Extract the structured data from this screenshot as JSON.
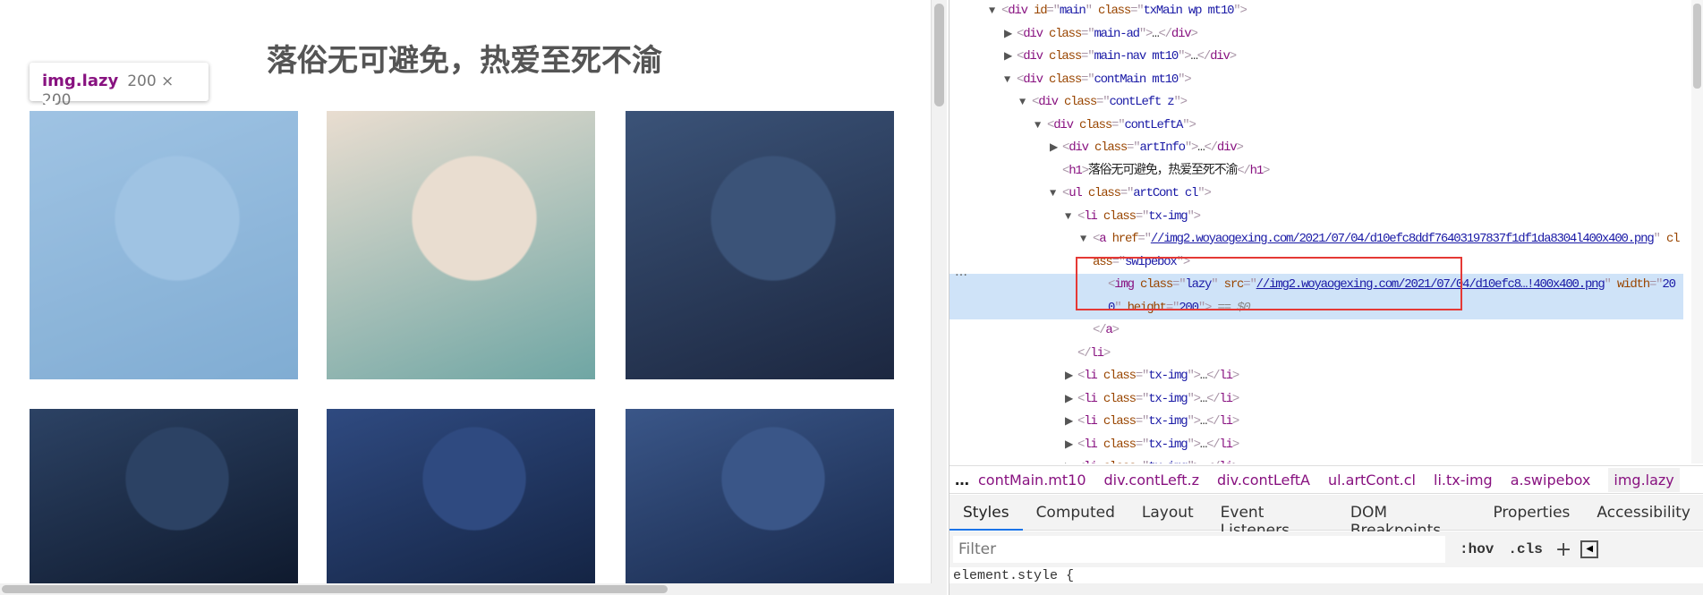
{
  "page": {
    "title": "落俗无可避免，热爱至死不渝",
    "photos": [
      {
        "alt": "photo-1",
        "colors": [
          "#c7d9ea",
          "#8fb0cc"
        ],
        "highlighted": true
      },
      {
        "alt": "photo-2",
        "colors": [
          "#e9ddd0",
          "#6fa6a4"
        ]
      },
      {
        "alt": "photo-3",
        "colors": [
          "#3b5378",
          "#1c2740"
        ]
      },
      {
        "alt": "photo-4",
        "colors": [
          "#2c4264",
          "#0f1a2e"
        ]
      },
      {
        "alt": "photo-5",
        "colors": [
          "#2f4a80",
          "#142444"
        ]
      },
      {
        "alt": "photo-6",
        "colors": [
          "#3a5688",
          "#18294c"
        ]
      }
    ],
    "tooltip": {
      "selector": "img.lazy",
      "size": "200 × 200"
    }
  },
  "devtools": {
    "tree": [
      {
        "level": 0,
        "arrow": "▼",
        "parts": [
          [
            "punct",
            "<"
          ],
          [
            "tag",
            "div"
          ],
          [
            "text",
            " "
          ],
          [
            "attr",
            "id"
          ],
          [
            "punct",
            "=\""
          ],
          [
            "val",
            "main"
          ],
          [
            "punct",
            "\" "
          ],
          [
            "attr",
            "class"
          ],
          [
            "punct",
            "=\""
          ],
          [
            "val",
            "txMain wp mt10"
          ],
          [
            "punct",
            "\">"
          ]
        ]
      },
      {
        "level": 1,
        "arrow": "▶",
        "parts": [
          [
            "punct",
            "<"
          ],
          [
            "tag",
            "div"
          ],
          [
            "text",
            " "
          ],
          [
            "attr",
            "class"
          ],
          [
            "punct",
            "=\""
          ],
          [
            "val",
            "main-ad"
          ],
          [
            "punct",
            "\">"
          ],
          [
            "text",
            "…"
          ],
          [
            "punct",
            "</"
          ],
          [
            "tag",
            "div"
          ],
          [
            "punct",
            ">"
          ]
        ]
      },
      {
        "level": 1,
        "arrow": "▶",
        "parts": [
          [
            "punct",
            "<"
          ],
          [
            "tag",
            "div"
          ],
          [
            "text",
            " "
          ],
          [
            "attr",
            "class"
          ],
          [
            "punct",
            "=\""
          ],
          [
            "val",
            "main-nav mt10"
          ],
          [
            "punct",
            "\">"
          ],
          [
            "text",
            "…"
          ],
          [
            "punct",
            "</"
          ],
          [
            "tag",
            "div"
          ],
          [
            "punct",
            ">"
          ]
        ]
      },
      {
        "level": 1,
        "arrow": "▼",
        "parts": [
          [
            "punct",
            "<"
          ],
          [
            "tag",
            "div"
          ],
          [
            "text",
            " "
          ],
          [
            "attr",
            "class"
          ],
          [
            "punct",
            "=\""
          ],
          [
            "val",
            "contMain mt10"
          ],
          [
            "punct",
            "\">"
          ]
        ]
      },
      {
        "level": 2,
        "arrow": "▼",
        "parts": [
          [
            "punct",
            "<"
          ],
          [
            "tag",
            "div"
          ],
          [
            "text",
            " "
          ],
          [
            "attr",
            "class"
          ],
          [
            "punct",
            "=\""
          ],
          [
            "val",
            "contLeft z"
          ],
          [
            "punct",
            "\">"
          ]
        ]
      },
      {
        "level": 3,
        "arrow": "▼",
        "parts": [
          [
            "punct",
            "<"
          ],
          [
            "tag",
            "div"
          ],
          [
            "text",
            " "
          ],
          [
            "attr",
            "class"
          ],
          [
            "punct",
            "=\""
          ],
          [
            "val",
            "contLeftA"
          ],
          [
            "punct",
            "\">"
          ]
        ]
      },
      {
        "level": 4,
        "arrow": "▶",
        "parts": [
          [
            "punct",
            "<"
          ],
          [
            "tag",
            "div"
          ],
          [
            "text",
            " "
          ],
          [
            "attr",
            "class"
          ],
          [
            "punct",
            "=\""
          ],
          [
            "val",
            "artInfo"
          ],
          [
            "punct",
            "\">"
          ],
          [
            "text",
            "…"
          ],
          [
            "punct",
            "</"
          ],
          [
            "tag",
            "div"
          ],
          [
            "punct",
            ">"
          ]
        ]
      },
      {
        "level": 4,
        "arrow": "",
        "parts": [
          [
            "punct",
            "<"
          ],
          [
            "tag",
            "h1"
          ],
          [
            "punct",
            ">"
          ],
          [
            "text",
            "落俗无可避免，热爱至死不渝"
          ],
          [
            "punct",
            "</"
          ],
          [
            "tag",
            "h1"
          ],
          [
            "punct",
            ">"
          ]
        ]
      },
      {
        "level": 4,
        "arrow": "▼",
        "parts": [
          [
            "punct",
            "<"
          ],
          [
            "tag",
            "ul"
          ],
          [
            "text",
            " "
          ],
          [
            "attr",
            "class"
          ],
          [
            "punct",
            "=\""
          ],
          [
            "val",
            "artCont cl"
          ],
          [
            "punct",
            "\">"
          ]
        ]
      },
      {
        "level": 5,
        "arrow": "▼",
        "parts": [
          [
            "punct",
            "<"
          ],
          [
            "tag",
            "li"
          ],
          [
            "text",
            " "
          ],
          [
            "attr",
            "class"
          ],
          [
            "punct",
            "=\""
          ],
          [
            "val",
            "tx-img"
          ],
          [
            "punct",
            "\">"
          ]
        ]
      },
      {
        "level": 6,
        "arrow": "▼",
        "wrap": true,
        "parts": [
          [
            "punct",
            "<"
          ],
          [
            "tag",
            "a"
          ],
          [
            "text",
            " "
          ],
          [
            "attr",
            "href"
          ],
          [
            "punct",
            "=\""
          ],
          [
            "link",
            "//img2.woyaogexing.com/2021/07/04/d10efc8ddf76403197837f1df1da8304l400x400.png"
          ],
          [
            "punct",
            "\" "
          ],
          [
            "attr",
            "class"
          ],
          [
            "punct",
            "=\""
          ],
          [
            "val",
            "swipebox"
          ],
          [
            "punct",
            "\">"
          ]
        ]
      },
      {
        "level": 7,
        "arrow": "",
        "wrap": true,
        "selected": true,
        "parts": [
          [
            "punct",
            "<"
          ],
          [
            "tag",
            "img"
          ],
          [
            "text",
            " "
          ],
          [
            "attr",
            "class"
          ],
          [
            "punct",
            "=\""
          ],
          [
            "val",
            "lazy"
          ],
          [
            "punct",
            "\" "
          ],
          [
            "attr",
            "src"
          ],
          [
            "punct",
            "=\""
          ],
          [
            "link",
            "//img2.woyaogexing.com/2021/07/04/d10efc8…!400x400.png"
          ],
          [
            "punct",
            "\" "
          ],
          [
            "attr",
            "width"
          ],
          [
            "punct",
            "=\""
          ],
          [
            "val",
            "200"
          ],
          [
            "punct",
            "\" "
          ],
          [
            "attr",
            "height"
          ],
          [
            "punct",
            "=\""
          ],
          [
            "val",
            "200"
          ],
          [
            "punct",
            "\">"
          ],
          [
            "eq",
            " == $0"
          ]
        ]
      },
      {
        "level": 6,
        "arrow": "",
        "parts": [
          [
            "punct",
            "</"
          ],
          [
            "tag",
            "a"
          ],
          [
            "punct",
            ">"
          ]
        ]
      },
      {
        "level": 5,
        "arrow": "",
        "parts": [
          [
            "punct",
            "</"
          ],
          [
            "tag",
            "li"
          ],
          [
            "punct",
            ">"
          ]
        ]
      },
      {
        "level": 5,
        "arrow": "▶",
        "parts": [
          [
            "punct",
            "<"
          ],
          [
            "tag",
            "li"
          ],
          [
            "text",
            " "
          ],
          [
            "attr",
            "class"
          ],
          [
            "punct",
            "=\""
          ],
          [
            "val",
            "tx-img"
          ],
          [
            "punct",
            "\">"
          ],
          [
            "text",
            "…"
          ],
          [
            "punct",
            "</"
          ],
          [
            "tag",
            "li"
          ],
          [
            "punct",
            ">"
          ]
        ]
      },
      {
        "level": 5,
        "arrow": "▶",
        "parts": [
          [
            "punct",
            "<"
          ],
          [
            "tag",
            "li"
          ],
          [
            "text",
            " "
          ],
          [
            "attr",
            "class"
          ],
          [
            "punct",
            "=\""
          ],
          [
            "val",
            "tx-img"
          ],
          [
            "punct",
            "\">"
          ],
          [
            "text",
            "…"
          ],
          [
            "punct",
            "</"
          ],
          [
            "tag",
            "li"
          ],
          [
            "punct",
            ">"
          ]
        ]
      },
      {
        "level": 5,
        "arrow": "▶",
        "parts": [
          [
            "punct",
            "<"
          ],
          [
            "tag",
            "li"
          ],
          [
            "text",
            " "
          ],
          [
            "attr",
            "class"
          ],
          [
            "punct",
            "=\""
          ],
          [
            "val",
            "tx-img"
          ],
          [
            "punct",
            "\">"
          ],
          [
            "text",
            "…"
          ],
          [
            "punct",
            "</"
          ],
          [
            "tag",
            "li"
          ],
          [
            "punct",
            ">"
          ]
        ]
      },
      {
        "level": 5,
        "arrow": "▶",
        "parts": [
          [
            "punct",
            "<"
          ],
          [
            "tag",
            "li"
          ],
          [
            "text",
            " "
          ],
          [
            "attr",
            "class"
          ],
          [
            "punct",
            "=\""
          ],
          [
            "val",
            "tx-img"
          ],
          [
            "punct",
            "\">"
          ],
          [
            "text",
            "…"
          ],
          [
            "punct",
            "</"
          ],
          [
            "tag",
            "li"
          ],
          [
            "punct",
            ">"
          ]
        ]
      },
      {
        "level": 5,
        "arrow": "▶",
        "parts": [
          [
            "punct",
            "<"
          ],
          [
            "tag",
            "li"
          ],
          [
            "text",
            " "
          ],
          [
            "attr",
            "class"
          ],
          [
            "punct",
            "=\""
          ],
          [
            "val",
            "tx-img"
          ],
          [
            "punct",
            "\">"
          ],
          [
            "text",
            "…"
          ],
          [
            "punct",
            "</"
          ],
          [
            "tag",
            "li"
          ],
          [
            "punct",
            ">"
          ]
        ]
      }
    ],
    "row_menu": "…",
    "breadcrumbs": {
      "more": "…",
      "items": [
        "contMain.mt10",
        "div.contLeft.z",
        "div.contLeftA",
        "ul.artCont.cl",
        "li.tx-img",
        "a.swipebox",
        "img.lazy"
      ]
    },
    "tabs": [
      "Styles",
      "Computed",
      "Layout",
      "Event Listeners",
      "DOM Breakpoints",
      "Properties",
      "Accessibility"
    ],
    "active_tab": "Styles",
    "filter": {
      "placeholder": "Filter",
      "value": ""
    },
    "hov": ":hov",
    "cls": ".cls",
    "plus": "+",
    "element_style": "element.style {",
    "colors": {
      "selection": "#cfe3f8",
      "highlight_box": "#e53935",
      "tag": "#881280",
      "attr": "#994500",
      "value": "#1a1aa6",
      "tab_accent": "#1a73e8"
    }
  }
}
